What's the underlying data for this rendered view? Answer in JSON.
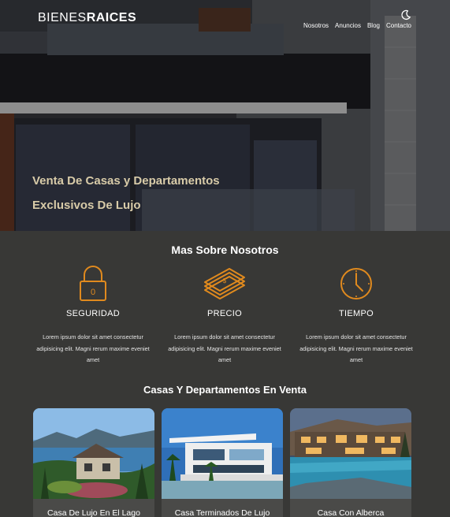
{
  "header": {
    "logo_light": "BIENES",
    "logo_bold": "RAICES",
    "nav": [
      "Nosotros",
      "Anuncios",
      "Blog",
      "Contacto"
    ],
    "theme_icon": "moon-icon"
  },
  "hero": {
    "title_line1": "Venta De Casas y Departamentos",
    "title_line2": "Exclusivos De Lujo"
  },
  "about": {
    "title": "Mas Sobre Nosotros",
    "features": [
      {
        "icon": "lock-icon",
        "heading": "SEGURIDAD",
        "text": "Lorem ipsum dolor sit amet consectetur adipisicing elit. Magni rerum maxime eveniet amet"
      },
      {
        "icon": "money-icon",
        "heading": "PRECIO",
        "text": "Lorem ipsum dolor sit amet consectetur adipisicing elit. Magni rerum maxime eveniet amet"
      },
      {
        "icon": "clock-icon",
        "heading": "TIEMPO",
        "text": "Lorem ipsum dolor sit amet consectetur adipisicing elit. Magni rerum maxime eveniet amet"
      }
    ]
  },
  "listings": {
    "title": "Casas Y Departamentos En Venta",
    "cards": [
      {
        "title": "Casa De Lujo En El Lago"
      },
      {
        "title": "Casa Terminados De Lujo"
      },
      {
        "title": "Casa Con Alberca"
      }
    ]
  },
  "colors": {
    "accent": "#e08a1e",
    "hero_text": "#d8cba8",
    "background": "#383836"
  }
}
